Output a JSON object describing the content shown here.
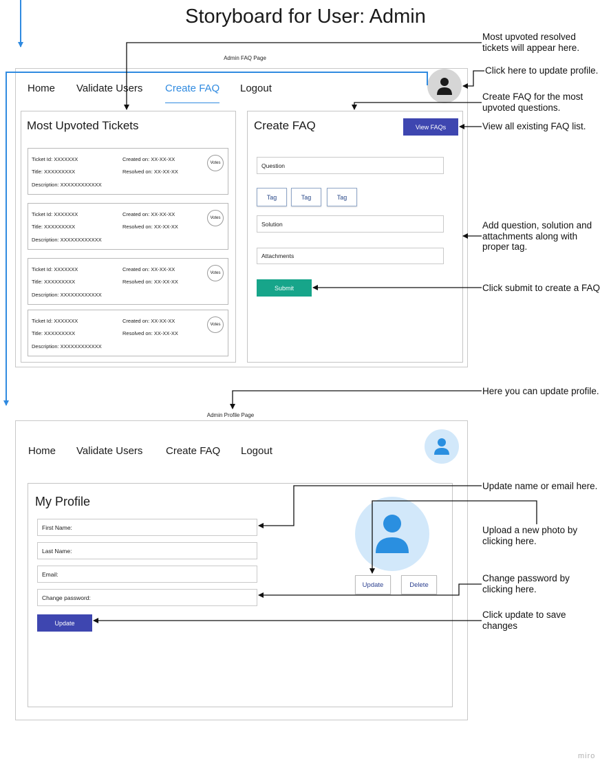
{
  "title": "Storyboard for User: Admin",
  "faq_page": {
    "caption": "Admin FAQ Page",
    "nav": [
      "Home",
      "Validate  Users",
      "Create FAQ",
      "Logout"
    ],
    "tickets_panel": {
      "title": "Most Upvoted Tickets",
      "tickets": [
        {
          "id": "Ticket Id: XXXXXXX",
          "title": "Title: XXXXXXXXX",
          "description": "Description: XXXXXXXXXXXX",
          "created": "Created on: XX-XX-XX",
          "resolved": "Resolved on: XX-XX-XX",
          "votes": "Votes"
        },
        {
          "id": "Ticket Id: XXXXXXX",
          "title": "Title: XXXXXXXXX",
          "description": "Description: XXXXXXXXXXXX",
          "created": "Created on: XX-XX-XX",
          "resolved": "Resolved on: XX-XX-XX",
          "votes": "Votes"
        },
        {
          "id": "Ticket Id: XXXXXXX",
          "title": "Title: XXXXXXXXX",
          "description": "Description: XXXXXXXXXXXX",
          "created": "Created on: XX-XX-XX",
          "resolved": "Resolved on: XX-XX-XX",
          "votes": "Votes"
        },
        {
          "id": "Ticket Id: XXXXXXX",
          "title": "Title: XXXXXXXXX",
          "description": "Description: XXXXXXXXXXXX",
          "created": "Created on: XX-XX-XX",
          "resolved": "Resolved on: XX-XX-XX",
          "votes": "Votes"
        }
      ]
    },
    "create_panel": {
      "title": "Create FAQ",
      "view_button": "View FAQs",
      "question_placeholder": "Question",
      "tags": [
        "Tag",
        "Tag",
        "Tag"
      ],
      "solution_placeholder": "Solution",
      "attachments_placeholder": "Attachments",
      "submit_label": "Submit"
    }
  },
  "profile_page": {
    "caption": "Admin Profile Page",
    "nav": [
      "Home",
      "Validate  Users",
      "Create FAQ",
      "Logout"
    ],
    "panel_title": "My Profile",
    "fields": [
      "First Name:",
      "Last Name:",
      "Email:",
      "Change password:"
    ],
    "photo_update": "Update",
    "photo_delete": "Delete",
    "update_button": "Update"
  },
  "notes": {
    "upvoted": "Most upvoted resolved tickets will appear here.",
    "click_profile": "Click here to update profile.",
    "create_faq": "Create FAQ for the most upvoted questions.",
    "view_faq": "View all existing FAQ list.",
    "add_question": "Add question, solution and attachments along with proper tag.",
    "submit": "Click submit to create a FAQ",
    "update_profile": "Here you can update profile.",
    "update_name": "Update name or email here.",
    "upload_photo": "Upload a  new photo by clicking here.",
    "change_password": "Change password by clicking here.",
    "click_update": "Click update to save changes"
  },
  "logo": "miro",
  "colors": {
    "accent": "#2f8ae0",
    "primary_button": "#3e46b0",
    "submit_button": "#17a58a",
    "avatar_bg": "#d2e8fa"
  }
}
